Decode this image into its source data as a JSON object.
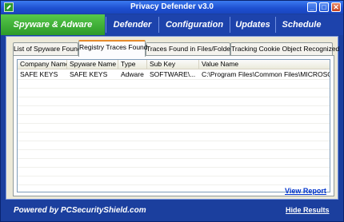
{
  "window": {
    "title": "Privacy Defender v3.0",
    "minimize_glyph": "_",
    "maximize_glyph": "□",
    "close_glyph": "✕"
  },
  "nav": {
    "items": [
      {
        "label": "Spyware & Adware",
        "active": true
      },
      {
        "label": "Defender",
        "active": false
      },
      {
        "label": "Configuration",
        "active": false
      },
      {
        "label": "Updates",
        "active": false
      },
      {
        "label": "Schedule",
        "active": false
      }
    ]
  },
  "tabs": [
    {
      "label": "List of Spyware Found",
      "active": false
    },
    {
      "label": "Registry Traces Found",
      "active": true
    },
    {
      "label": "Traces Found in Files/Folders",
      "active": false
    },
    {
      "label": "Tracking Cookie Object Recognized",
      "active": false
    }
  ],
  "table": {
    "columns": [
      "Company Name",
      "Spyware Name",
      "Type",
      "Sub Key",
      "Value Name"
    ],
    "rows": [
      [
        "SAFE KEYS",
        "SAFE KEYS",
        "Adware",
        "SOFTWARE\\...",
        "C:\\Program Files\\Common Files\\MICROSOFT ..."
      ]
    ]
  },
  "links": {
    "view_report": "View Report",
    "hide_results": "Hide Results"
  },
  "footer": {
    "powered_by": "Powered by",
    "site": "PCSecurityShield.com"
  },
  "colors": {
    "frame": "#1b3f9e",
    "active_nav": "#3aa832",
    "active_tab_accent": "#e68b2c",
    "link": "#0033cc"
  }
}
